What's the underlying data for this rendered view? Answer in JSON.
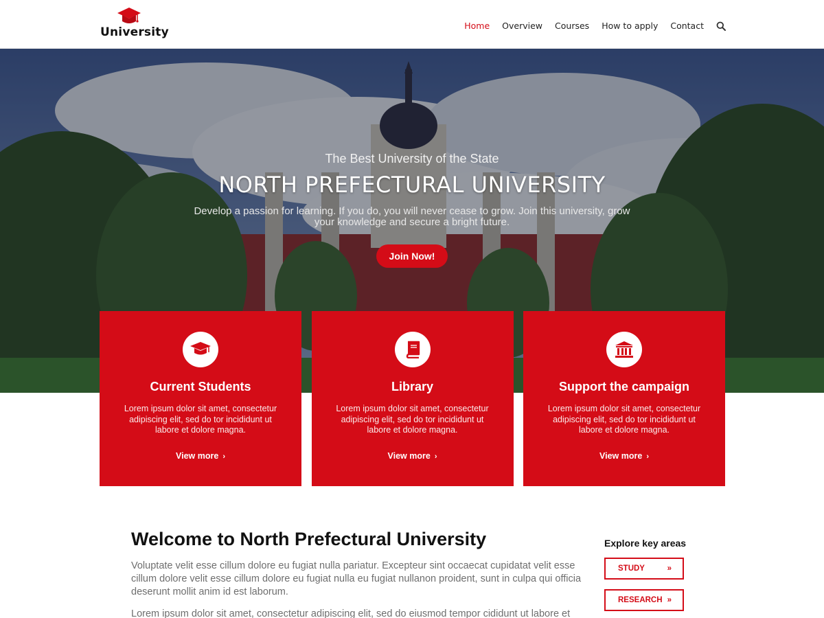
{
  "colors": {
    "accent": "#d40c17",
    "text_dark": "#111111",
    "text_muted": "#6e6e6e"
  },
  "header": {
    "logo_text": "University",
    "logo_icon": "graduation-cap-icon",
    "nav": [
      {
        "label": "Home",
        "active": true
      },
      {
        "label": "Overview",
        "active": false
      },
      {
        "label": "Courses",
        "active": false
      },
      {
        "label": "How to apply",
        "active": false
      },
      {
        "label": "Contact",
        "active": false
      }
    ],
    "search_icon": "search-icon"
  },
  "hero": {
    "tagline": "The Best University of the State",
    "title": "NORTH PREFECTURAL UNIVERSITY",
    "description": "Develop a passion for learning. If you do, you will never cease to grow. Join this university, grow your knowledge and secure a bright future.",
    "cta_label": "Join Now!"
  },
  "cards": [
    {
      "icon": "graduation-cap-icon",
      "title": "Current Students",
      "text": "Lorem ipsum dolor sit amet, consectetur adipiscing elit, sed do tor incididunt ut labore et dolore magna.",
      "link_label": "View more"
    },
    {
      "icon": "book-icon",
      "title": "Library",
      "text": "Lorem ipsum dolor sit amet, consectetur adipiscing elit, sed do tor incididunt ut labore et dolore magna.",
      "link_label": "View more"
    },
    {
      "icon": "institution-icon",
      "title": "Support the campaign",
      "text": "Lorem ipsum dolor sit amet, consectetur adipiscing elit, sed do tor incididunt ut labore et dolore magna.",
      "link_label": "View more"
    }
  ],
  "welcome": {
    "title": "Welcome to North Prefectural University",
    "paragraphs": [
      "Voluptate velit esse cillum dolore eu fugiat nulla pariatur. Excepteur sint occaecat cupidatat velit esse cillum dolore velit esse cillum dolore eu fugiat nulla eu fugiat nullanon proident, sunt in culpa qui officia deserunt mollit anim id est laborum.",
      "Lorem ipsum dolor sit amet, consectetur adipiscing elit, sed do eiusmod tempor cididunt ut labore et dolore"
    ]
  },
  "explore": {
    "heading": "Explore key areas",
    "buttons": [
      {
        "label": "STUDY"
      },
      {
        "label": "RESEARCH"
      }
    ]
  }
}
